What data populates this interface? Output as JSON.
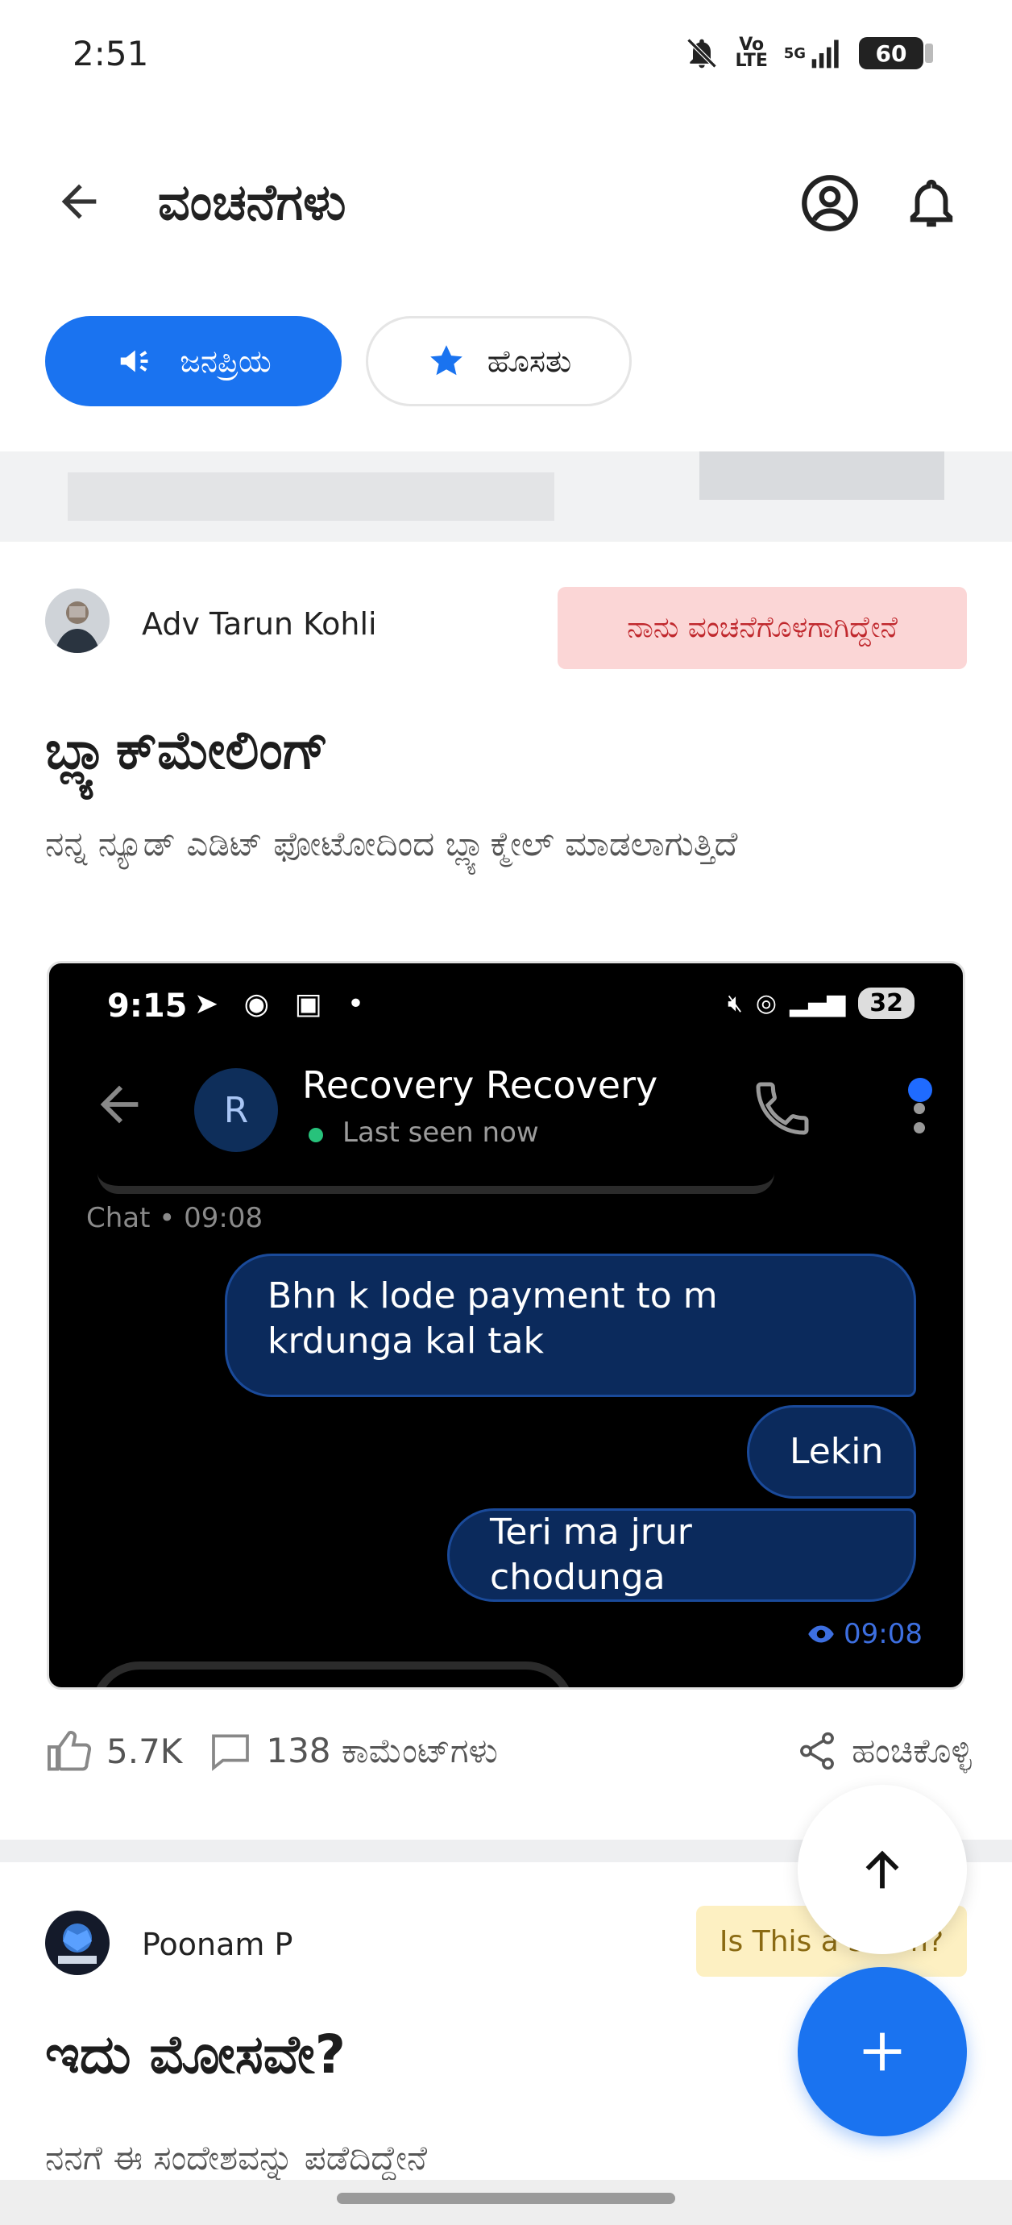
{
  "status_bar": {
    "time": "2:51",
    "volte": "Vo LTE",
    "network": "5G",
    "battery": "60"
  },
  "app_bar": {
    "title": "ವಂಚನೆಗಳು"
  },
  "tabs": [
    {
      "label": "ಜನಪ್ರಿಯ",
      "selected": true,
      "icon": "megaphone-icon"
    },
    {
      "label": "ಹೊಸತು",
      "selected": false,
      "icon": "star-icon"
    }
  ],
  "posts": [
    {
      "author": "Adv Tarun Kohli",
      "tag": "ನಾನು ವಂಚನೆಗೊಳಗಾಗಿದ್ದೇನೆ",
      "title": "ಬ್ಲ್ಯಾಕ್‌ಮೇಲಿಂಗ್",
      "body": "ನನ್ನ ನ್ಯೂಡ್ ಎಡಿಟ್ ಫೋಟೋದಿಂದ ಬ್ಲ್ಯಾಕ್ಮೇಲ್ ಮಾಡಲಾಗುತ್ತಿದೆ",
      "screenshot": {
        "time": "9:15",
        "battery": "32",
        "contact_initial": "R",
        "contact_name": "Recovery Recovery",
        "last_seen": "Last seen now",
        "chat_label": "Chat • 09:08",
        "messages": [
          "Bhn k lode payment to m krdunga kal tak",
          "Lekin",
          "Teri ma jrur chodunga"
        ],
        "read_time": "09:08"
      },
      "likes": "5.7K",
      "comments": "138 ಕಾಮೆಂಟ್‌ಗಳು",
      "share": "ಹಂಚಿಕೊಳ್ಳಿ"
    },
    {
      "author": "Poonam P",
      "tag": "Is This a Scam?",
      "title": "ಇದು ಮೋಸವೇ?",
      "body": "ನನಗೆ ಈ ಸಂದೇಶವನ್ನು ಪಡೆದಿದ್ದೇನೆ"
    }
  ],
  "colors": {
    "primary": "#1a73f0",
    "tag_red_bg": "#fbd6d6",
    "tag_red_text": "#c0282d",
    "tag_yellow_bg": "#fdf0c2"
  }
}
